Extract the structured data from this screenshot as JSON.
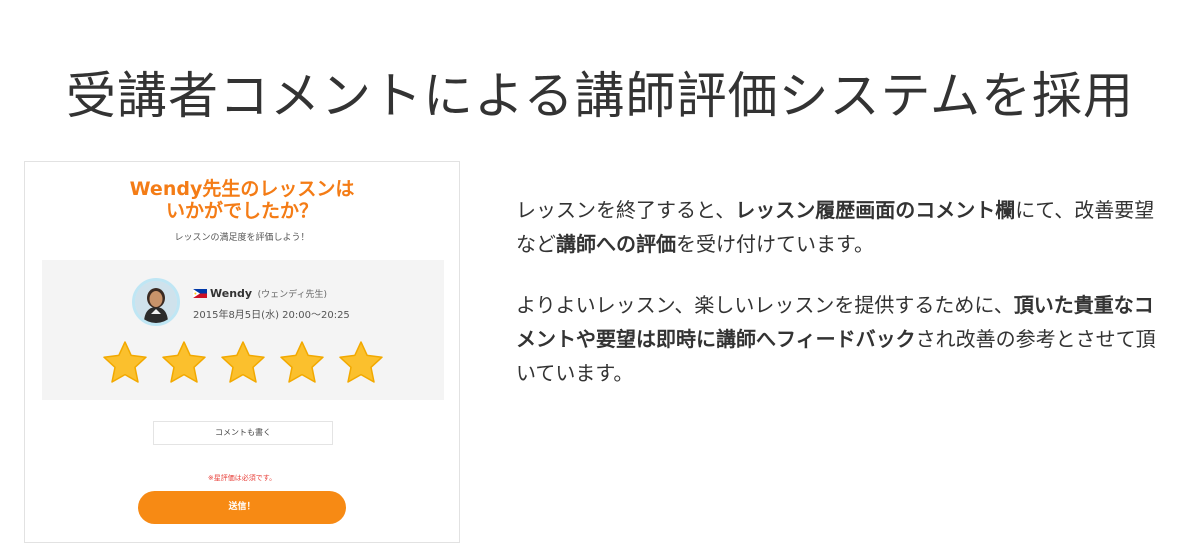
{
  "page": {
    "title": "受講者コメントによる講師評価システムを採用"
  },
  "card": {
    "heading_line1": "Wendy先生のレッスンは",
    "heading_line2": "いかがでしたか？",
    "subheading": "レッスンの満足度を評価しよう！",
    "teacher": {
      "name": "Wendy",
      "kana": "(ウェンディ先生)",
      "datetime": "2015年8月5日(水) 20:00〜20:25",
      "flag_icon": "philippines-flag-icon",
      "avatar_icon": "teacher-avatar"
    },
    "rating": {
      "value": 5,
      "max": 5,
      "star_color": "#fbc02d"
    },
    "comment_placeholder": "コメントも書く",
    "required_note": "※星評価は必須です。",
    "submit_label": "送信！",
    "colors": {
      "heading": "#f47c16",
      "button": "#f78a14",
      "note": "#e8403a"
    }
  },
  "description": {
    "para1": [
      {
        "text": "レッスンを終了すると、",
        "bold": false
      },
      {
        "text": "レッスン履歴画面のコメント欄",
        "bold": true
      },
      {
        "text": "にて、改善要望など",
        "bold": false
      },
      {
        "text": "講師への評価",
        "bold": true
      },
      {
        "text": "を受け付けています。",
        "bold": false
      }
    ],
    "para2": [
      {
        "text": "よりよいレッスン、楽しいレッスンを提供するために、",
        "bold": false
      },
      {
        "text": "頂いた貴重なコメントや要望は即時に講師へフィードバック",
        "bold": true
      },
      {
        "text": "され改善の参考とさせて頂いています。",
        "bold": false
      }
    ]
  }
}
